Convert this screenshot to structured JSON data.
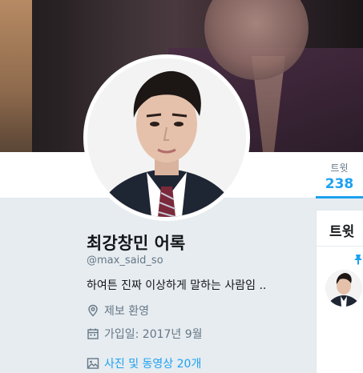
{
  "profile": {
    "name": "최강창민 어록",
    "handle": "@max_said_so",
    "bio": "하여튼 진짜 이상하게 말하는 사람임 ..",
    "location": "제보 환영",
    "joined": "가입일: 2017년 9월",
    "media_link": "사진 및 동영상 20개"
  },
  "nav": {
    "tweets_label": "트윗",
    "tweets_count": "238"
  },
  "side": {
    "title": "트윗"
  },
  "icons": {
    "location": "location-pin-icon",
    "joined": "calendar-icon",
    "media": "image-icon",
    "pin": "pin-icon"
  },
  "colors": {
    "accent": "#1da1f2",
    "background": "#e6ecf0",
    "muted": "#657786"
  }
}
